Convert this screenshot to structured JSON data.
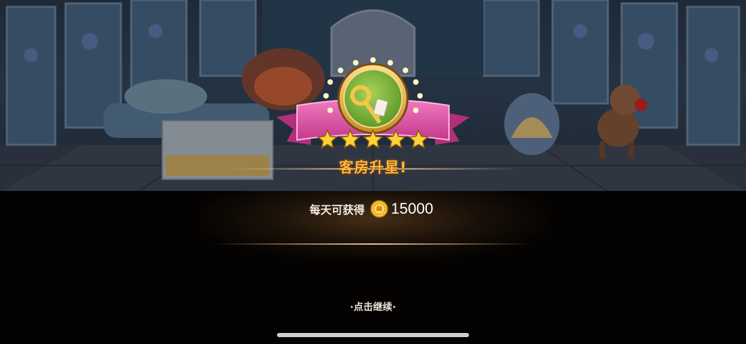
{
  "popup": {
    "title": "客房升星!",
    "reward_label": "每天可获得",
    "reward_amount": "15000",
    "continue_hint": "·点击继续·",
    "stars_filled": 5,
    "stars_total": 5
  },
  "icons": {
    "badge": "key-tag-icon",
    "currency": "gold-coin-icon",
    "star": "star-icon"
  },
  "colors": {
    "title": "#ffb93c",
    "ribbon": "#e04fa6",
    "badge_green": "#7fb53a",
    "star_gold": "#ffd23a",
    "panel": "#050302"
  }
}
